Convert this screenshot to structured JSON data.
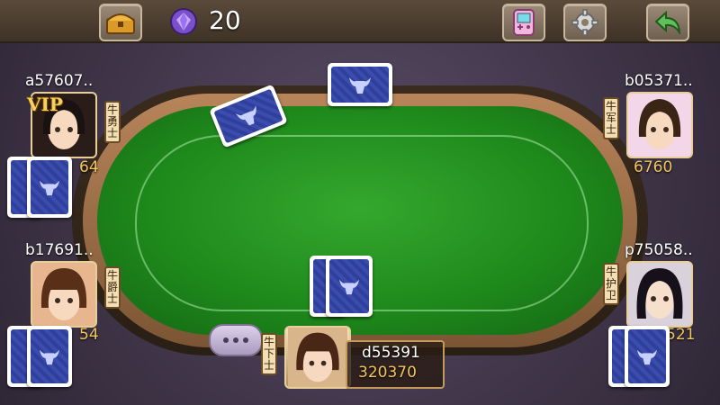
{
  "topbar": {
    "gem_count": "20",
    "icons": [
      "treasure-chest-icon",
      "purple-gem-icon",
      "gamepad-icon",
      "gear-icon",
      "back-arrow-icon"
    ]
  },
  "players": {
    "top_left": {
      "name": "a57607..",
      "chips": "64",
      "title": "牛勇士",
      "vip": "VIP"
    },
    "top_right": {
      "name": "b05371..",
      "chips": "6760",
      "title": "牛军士"
    },
    "mid_left": {
      "name": "b17691..",
      "chips": "54",
      "title": "牛爵士"
    },
    "mid_right": {
      "name": "p75058..",
      "chips": "521",
      "title": "牛护卫"
    },
    "self": {
      "name": "d55391",
      "chips": "320370",
      "title": "牛下士"
    }
  },
  "colors": {
    "felt": "#1f8a1c",
    "rail": "#b8845a",
    "chips": "#f2c45a",
    "card_back": "#2f3f9a"
  }
}
